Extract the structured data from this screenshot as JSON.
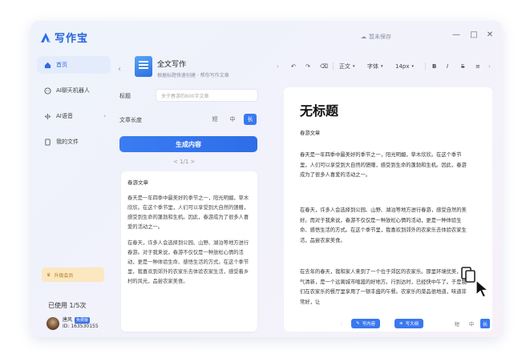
{
  "app": {
    "name": "写作宝",
    "save_status": "暂未保存"
  },
  "window_controls": [
    "—",
    "□",
    "✕"
  ],
  "sidebar": {
    "items": [
      {
        "label": "首页",
        "icon": "home-icon"
      },
      {
        "label": "AI聊天机器人",
        "icon": "chat-icon"
      },
      {
        "label": "AI语音",
        "icon": "voice-icon"
      },
      {
        "label": "我的文件",
        "icon": "file-icon"
      }
    ],
    "upgrade_label": "升级会员",
    "usage": "已使用 1/5次",
    "user": {
      "name": "唐风",
      "badge": "免费版",
      "id": "ID: 163530155"
    }
  },
  "tool": {
    "title": "全文写作",
    "description": "根据标题快速创建 · 帮你写作文章",
    "title_label": "标题",
    "title_placeholder": "关于春游的600字文章",
    "length_label": "文章长度",
    "length_options": [
      "短",
      "中",
      "长"
    ],
    "generate_label": "生成内容",
    "pager": "< 1/1 >"
  },
  "result": {
    "title": "春游文章",
    "paragraphs": [
      "春天是一年四季中最美好的季节之一，阳光明媚，草木欣欣。在这个季节里，人们可以享受到大自然的馈赠，感受到生命的蓬勃和生机。因此，春游成为了很多人喜爱的活动之一。",
      "在春天，许多人会选择到公园、山野、湖泊等地方进行春游。对于我来说，春游不仅仅是一种放松心情的活动，更是一种体验生命、感悟生活的方式。在这个季节里，我喜欢到郊外的农家乐去体验农家生活，感受着乡村的风光，品尝农家美食。"
    ]
  },
  "toolbar": {
    "undo": "↶",
    "redo": "↷",
    "paragraph": "正文",
    "font": "字体",
    "size": "14px",
    "bold": "B",
    "italic": "I",
    "underline": "S"
  },
  "editor": {
    "title": "无标题",
    "subtitle": "春游文章",
    "paragraphs": [
      "春天是一年四季中最美好的季节之一，阳光明媚，草木欣欣。在这个季节里，人们可以享受到大自然的馈赠，感受到生命的蓬勃和生机。因此，春游成为了很多人喜爱的活动之一。",
      "在春天，许多人会选择到公园、山野、湖泊等地方进行春游，感受自然的美好。而对于我来说，春游不仅仅是一种放松心情的活动，更是一种体验生命、感悟生活的方式。在这个季节里，我喜欢到郊外的农家乐去体验农家生活，品尝农家美食。",
      "在去年的春天，我和家人来到了一个位于郊区的农家乐。那里环境优美，空气清新，是一个远离城市喧嚣的好地方。行到达时，已经快中午了。于是我们在农家乐的餐厅里享用了一顿丰盛的午餐。农家乐的菜品很地道，味道非常好，让"
    ],
    "footer": {
      "continue": "写内容",
      "expand": "写大纲",
      "page_a": "短",
      "page_b": "中",
      "page_c": "长"
    }
  },
  "colors": {
    "accent": "#3a78f0",
    "brand": "#2364d8"
  }
}
